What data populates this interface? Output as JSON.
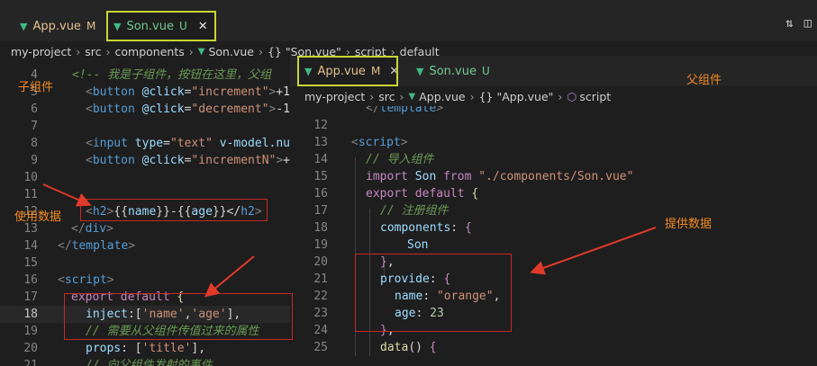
{
  "tabs": [
    {
      "label": "App.vue",
      "status": "M",
      "active": false
    },
    {
      "label": "Son.vue",
      "status": "U",
      "active": true
    }
  ],
  "breadcrumb": [
    "my-project",
    "src",
    "components",
    "Son.vue",
    "{} \"Son.vue\"",
    "script",
    "default"
  ],
  "editor_lines": [
    {
      "n": "4",
      "html": "<span class=\"cm\">&lt;!-- 我是子组件，按钮在这里，父组</span>"
    },
    {
      "n": "5",
      "html": "<span class=\"ang\">&lt;</span><span class=\"tag\">button</span> <span class=\"attr\">@click</span><span class=\"pl\">=</span><span class=\"str\">\"increment\"</span><span class=\"ang\">&gt;</span><span class=\"pl\">+1&lt;</span>"
    },
    {
      "n": "6",
      "html": "<span class=\"ang\">&lt;</span><span class=\"tag\">button</span> <span class=\"attr\">@click</span><span class=\"pl\">=</span><span class=\"str\">\"decrement\"</span><span class=\"ang\">&gt;</span><span class=\"pl\">-1&lt;</span>"
    },
    {
      "n": "7",
      "html": ""
    },
    {
      "n": "8",
      "html": "<span class=\"ang\">&lt;</span><span class=\"tag\">input</span> <span class=\"attr\">type</span><span class=\"pl\">=</span><span class=\"str\">\"text\"</span> <span class=\"attr\">v-model.num</span>"
    },
    {
      "n": "9",
      "html": "<span class=\"ang\">&lt;</span><span class=\"tag\">button</span> <span class=\"attr\">@click</span><span class=\"pl\">=</span><span class=\"str\">\"incrementN\"</span><span class=\"ang\">&gt;</span><span class=\"pl\">+n</span>"
    },
    {
      "n": "10",
      "html": ""
    },
    {
      "n": "11",
      "html": ""
    },
    {
      "n": "12",
      "html": "<span class=\"ang\">&lt;</span><span class=\"tag\">h2</span><span class=\"ang\">&gt;</span><span class=\"pl\">{{</span><span class=\"attr\">name</span><span class=\"pl\">}}-{{</span><span class=\"attr\">age</span><span class=\"pl\">}}&lt;/</span><span class=\"tag\">h2</span><span class=\"ang\">&gt;</span>"
    },
    {
      "n": "13",
      "html": "<span class=\"ang\">&lt;/</span><span class=\"tag\">div</span><span class=\"ang\">&gt;</span>"
    },
    {
      "n": "14",
      "html": "<span class=\"ang\">&lt;/</span><span class=\"tag\">template</span><span class=\"ang\">&gt;</span>"
    },
    {
      "n": "15",
      "html": ""
    },
    {
      "n": "16",
      "html": "<span class=\"ang\">&lt;</span><span class=\"tag\">script</span><span class=\"ang\">&gt;</span>"
    },
    {
      "n": "17",
      "html": "<span class=\"kw\">export</span> <span class=\"kw\">default</span> <span class=\"yel\">{</span>"
    },
    {
      "n": "18",
      "html": "<span class=\"attr\">inject</span><span class=\"pl\">:[</span><span class=\"str\">'name'</span><span class=\"pl\">,</span><span class=\"str\">'age'</span><span class=\"pl\">],</span>"
    },
    {
      "n": "19",
      "html": "<span class=\"cm\">// 需要从父组件传值过来的属性</span>"
    },
    {
      "n": "20",
      "html": "<span class=\"attr\">props</span><span class=\"pl\">: [</span><span class=\"str\">'title'</span><span class=\"pl\">],</span>"
    },
    {
      "n": "21",
      "html": "<span class=\"cm\">// 向父组件发射的事件</span>"
    }
  ],
  "panel": {
    "tabs": [
      {
        "label": "App.vue",
        "status": "M",
        "active": true
      },
      {
        "label": "Son.vue",
        "status": "U",
        "active": false
      }
    ],
    "breadcrumb": [
      "my-project",
      "src",
      "App.vue",
      "{} \"App.vue\"",
      "script"
    ],
    "lines": [
      {
        "n": "",
        "html": "<span class=\"ang\">&lt;/</span><span class=\"tag\">template</span><span class=\"ang\">&gt;</span>"
      },
      {
        "n": "12",
        "html": ""
      },
      {
        "n": "13",
        "html": "<span class=\"ang\">&lt;</span><span class=\"tag\">script</span><span class=\"ang\">&gt;</span>"
      },
      {
        "n": "14",
        "html": "<span class=\"cm\">// 导入组件</span>"
      },
      {
        "n": "15",
        "html": "<span class=\"kw\">import</span> <span class=\"attr\">Son</span> <span class=\"kw\">from</span> <span class=\"str\">\"./components/Son.vue\"</span>"
      },
      {
        "n": "16",
        "html": "<span class=\"kw\">export</span> <span class=\"kw\">default</span> <span class=\"yel\">{</span>"
      },
      {
        "n": "17",
        "html": "<span class=\"cm\">// 注册组件</span>"
      },
      {
        "n": "18",
        "html": "<span class=\"attr\">components</span><span class=\"pl\">: </span><span class=\"kw\">{</span>"
      },
      {
        "n": "19",
        "html": "<span class=\"attr\">Son</span>"
      },
      {
        "n": "20",
        "html": "<span class=\"kw\">}</span><span class=\"pl\">,</span>"
      },
      {
        "n": "21",
        "html": "<span class=\"attr\">provide</span><span class=\"pl\">: </span><span class=\"kw\">{</span>"
      },
      {
        "n": "22",
        "html": "<span class=\"attr\">name</span><span class=\"pl\">: </span><span class=\"str\">\"orange\"</span><span class=\"pl\">,</span>"
      },
      {
        "n": "23",
        "html": "<span class=\"attr\">age</span><span class=\"pl\">: </span><span class=\"num\">23</span>"
      },
      {
        "n": "24",
        "html": "<span class=\"kw\">}</span><span class=\"pl\">,</span>"
      },
      {
        "n": "25",
        "html": "<span class=\"yel\">data</span><span class=\"pl\">() </span><span class=\"kw\">{</span>"
      }
    ]
  },
  "annotations": {
    "child": "子组件",
    "parent": "父组件",
    "use_data": "使用数据",
    "provide_data": "提供数据"
  },
  "colors": {
    "annotation": "#f08a24",
    "highlight_box": "#c8282a",
    "active_tab_outline": "#c8d632",
    "vue": "#41b883"
  }
}
